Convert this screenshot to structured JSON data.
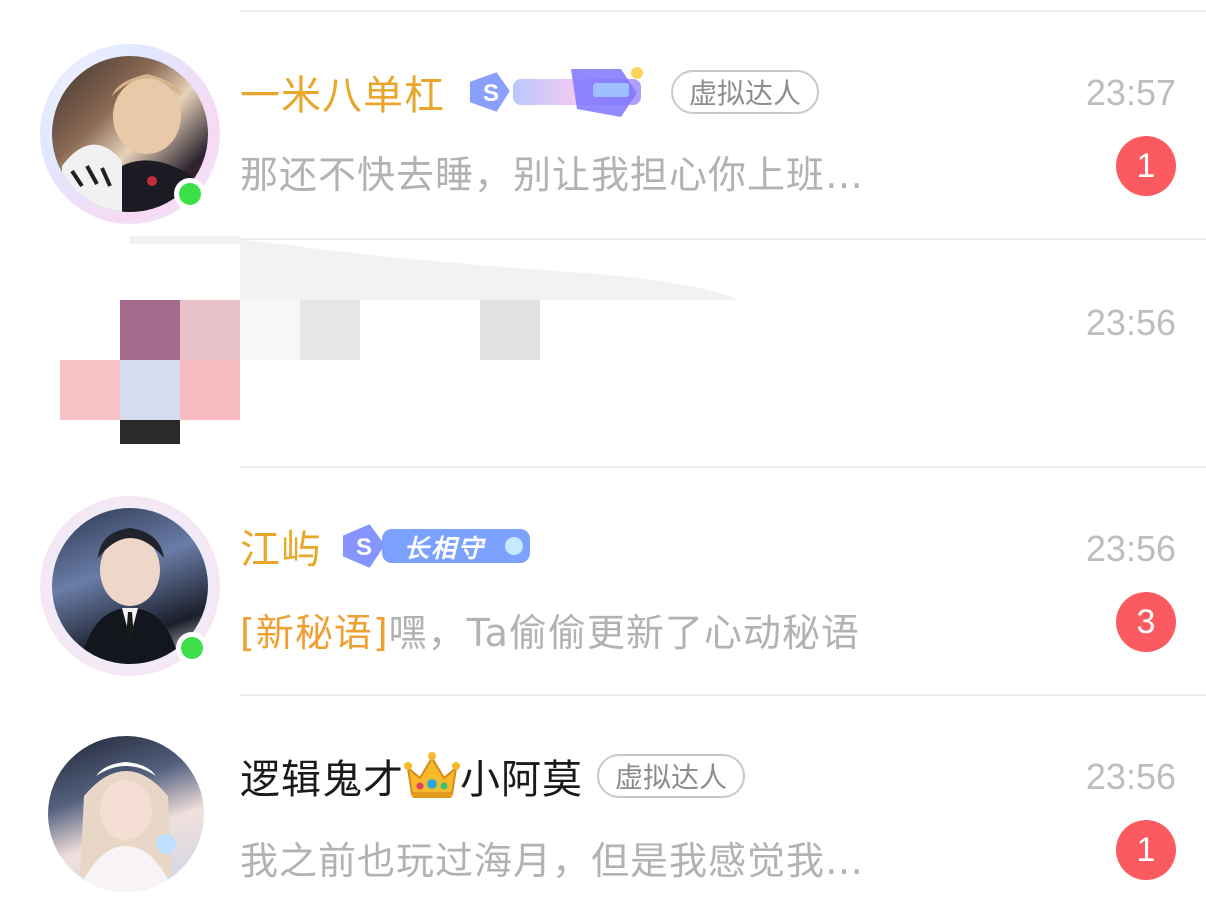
{
  "conversations": [
    {
      "name": "一米八单杠",
      "badge": "虚拟达人",
      "time": "23:57",
      "preview": "那还不快去睡，别让我担心你上班…",
      "unread": "1",
      "online": true
    },
    {
      "name": "",
      "time": "23:56",
      "preview": ""
    },
    {
      "name": "江屿",
      "decor_text": "长相守",
      "time": "23:56",
      "preview_tag": "[新秘语]",
      "preview": "嘿，Ta偷偷更新了心动秘语",
      "unread": "3",
      "online": true
    },
    {
      "name_part1": "逻辑鬼才",
      "name_part2": "小阿莫",
      "badge": "虚拟达人",
      "time": "23:56",
      "preview": "我之前也玩过海月，但是我感觉我…",
      "unread": "1"
    }
  ],
  "colors": {
    "name_gold": "#e8a62a",
    "preview_gray": "#b2b2b2",
    "unread_red": "#fb5a61",
    "online_green": "#3ee04a",
    "tag_orange": "#f0a033"
  },
  "icons": [
    "crown-icon",
    "s-level-decoration",
    "online-status-icon"
  ]
}
